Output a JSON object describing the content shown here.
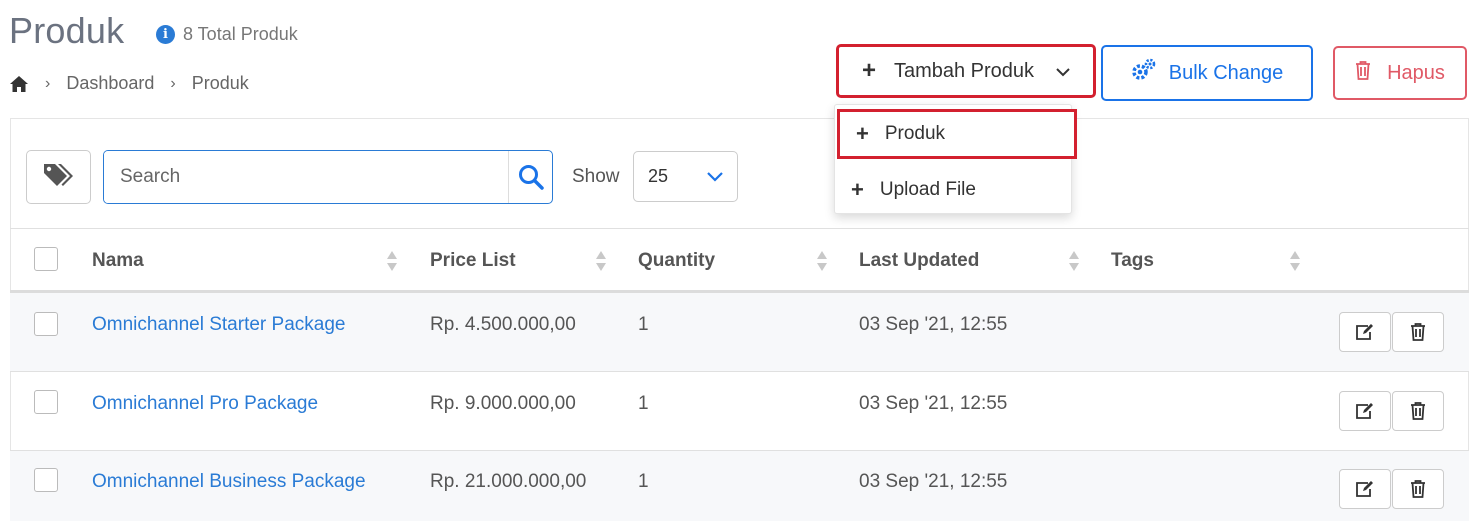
{
  "header": {
    "title": "Produk",
    "total_text": "8 Total Produk"
  },
  "breadcrumb": {
    "items": [
      "Dashboard",
      "Produk"
    ]
  },
  "actions": {
    "tambah_label": "Tambah Produk",
    "bulk_label": "Bulk Change",
    "hapus_label": "Hapus"
  },
  "dropdown": {
    "items": [
      {
        "label": "Produk"
      },
      {
        "label": "Upload File"
      }
    ]
  },
  "toolbar": {
    "search_placeholder": "Search",
    "show_label": "Show",
    "show_value": "25"
  },
  "table": {
    "columns": [
      "Nama",
      "Price List",
      "Quantity",
      "Last Updated",
      "Tags"
    ],
    "rows": [
      {
        "nama": "Omnichannel Starter Package",
        "price": "Rp. 4.500.000,00",
        "qty": "1",
        "updated": "03 Sep '21, 12:55",
        "tags": ""
      },
      {
        "nama": "Omnichannel Pro Package",
        "price": "Rp. 9.000.000,00",
        "qty": "1",
        "updated": "03 Sep '21, 12:55",
        "tags": ""
      },
      {
        "nama": "Omnichannel Business Package",
        "price": "Rp. 21.000.000,00",
        "qty": "1",
        "updated": "03 Sep '21, 12:55",
        "tags": ""
      }
    ]
  },
  "colors": {
    "accent": "#2a7bd5",
    "danger": "#e05966",
    "highlight": "#d3202f"
  },
  "icons": {
    "info": "info-icon",
    "home": "home-icon",
    "tag": "tags-icon",
    "search": "search-icon",
    "gear": "gears-icon",
    "trash": "trash-icon",
    "edit": "edit-icon"
  }
}
